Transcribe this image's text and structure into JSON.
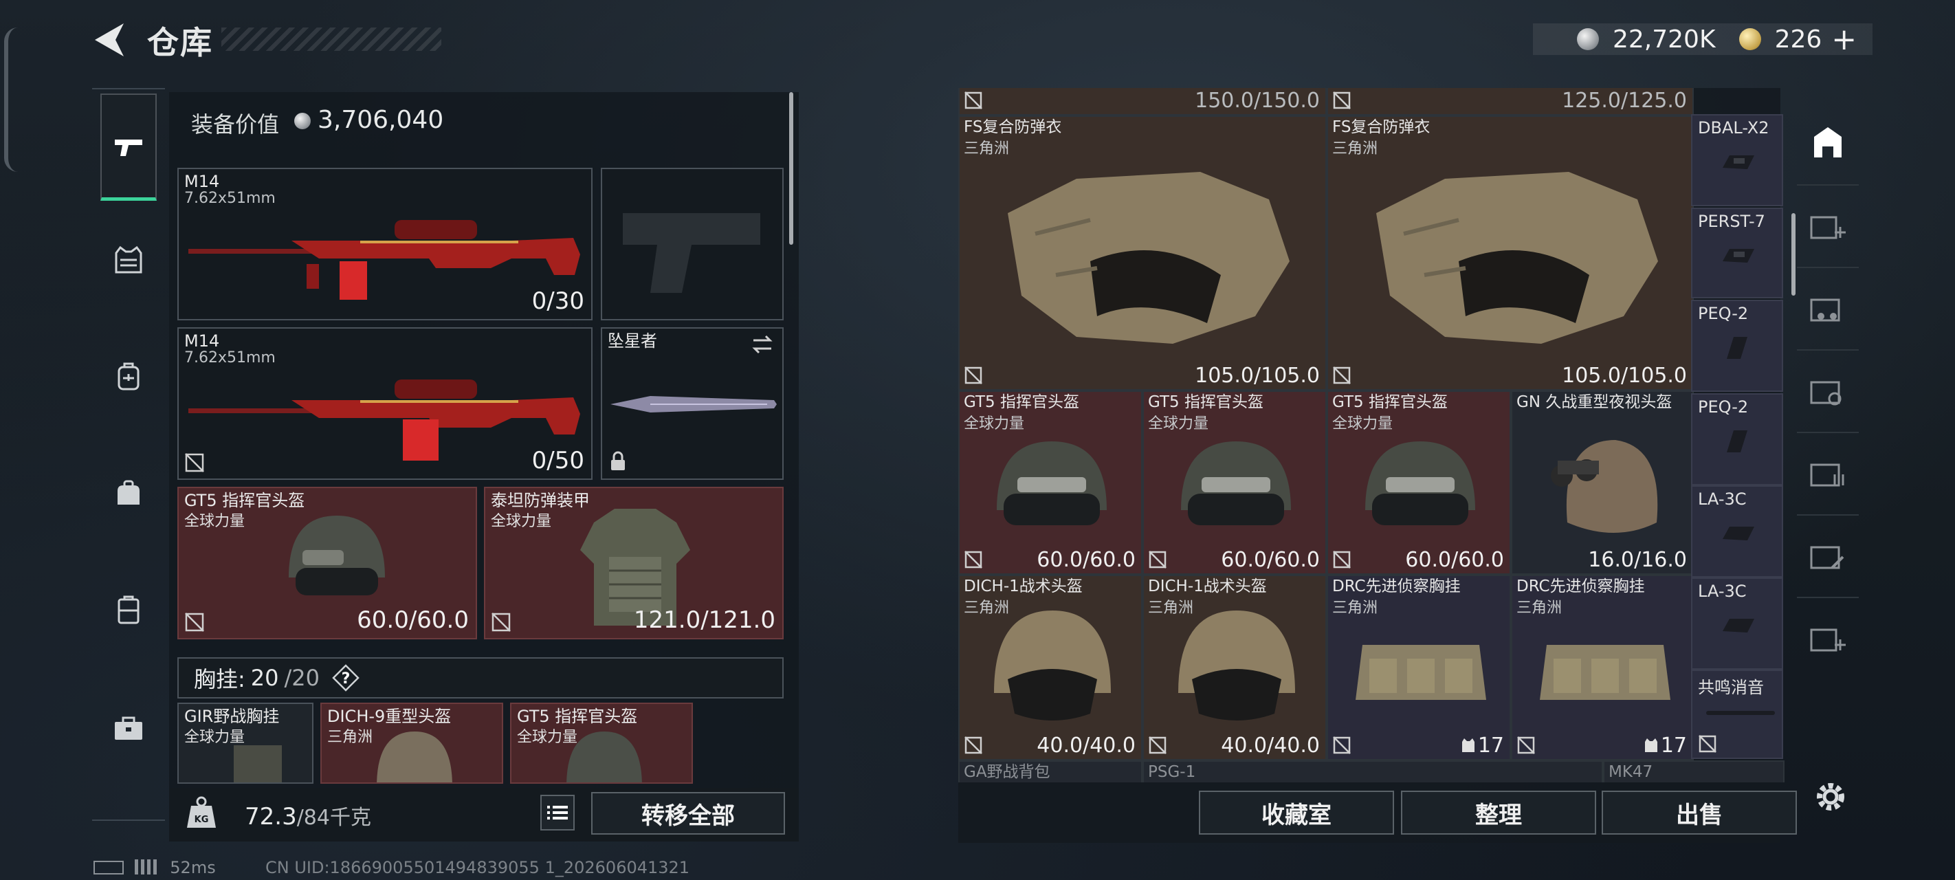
{
  "header": {
    "title": "仓库",
    "currency_silver": "22,720K",
    "currency_gold": "226",
    "currency_add": "+"
  },
  "left_panel": {
    "equip_value_label": "装备价值",
    "equip_value": "3,706,040",
    "weapon1": {
      "name": "M14",
      "caliber": "7.62x51mm",
      "ammo": "0/30"
    },
    "weapon2": {
      "name": "M14",
      "caliber": "7.62x51mm",
      "ammo": "0/50"
    },
    "melee": {
      "name": "坠星者"
    },
    "helmet": {
      "name": "GT5 指挥官头盔",
      "faction": "全球力量",
      "durability": "60.0/60.0"
    },
    "armor": {
      "name": "泰坦防弹装甲",
      "faction": "全球力量",
      "durability": "121.0/121.0"
    },
    "chest_rig": {
      "label": "胸挂:",
      "value": "20",
      "max": "/20",
      "help": "?"
    },
    "rig_items": [
      {
        "name": "GIR野战胸挂",
        "faction": "全球力量"
      },
      {
        "name": "DICH-9重型头盔",
        "faction": "三角洲"
      },
      {
        "name": "GT5 指挥官头盔",
        "faction": "全球力量"
      }
    ],
    "weight": "72.3",
    "weight_max": "/84千克",
    "transfer_all": "转移全部"
  },
  "stash": {
    "row0": [
      "150.0/150.0",
      "125.0/125.0"
    ],
    "vests": [
      {
        "name": "FS复合防弹衣",
        "faction": "三角洲",
        "durability": "105.0/105.0"
      },
      {
        "name": "FS复合防弹衣",
        "faction": "三角洲",
        "durability": "105.0/105.0"
      }
    ],
    "helmets_row": [
      {
        "name": "GT5 指挥官头盔",
        "faction": "全球力量",
        "durability": "60.0/60.0"
      },
      {
        "name": "GT5 指挥官头盔",
        "faction": "全球力量",
        "durability": "60.0/60.0"
      },
      {
        "name": "GT5 指挥官头盔",
        "faction": "全球力量",
        "durability": "60.0/60.0"
      },
      {
        "name": "GN 久战重型夜视头盔",
        "faction": "",
        "durability": "16.0/16.0"
      }
    ],
    "row3": [
      {
        "name": "DICH-1战术头盔",
        "faction": "三角洲",
        "value": "40.0/40.0"
      },
      {
        "name": "DICH-1战术头盔",
        "faction": "三角洲",
        "value": "40.0/40.0"
      },
      {
        "name": "DRC先进侦察胸挂",
        "faction": "三角洲",
        "value": "17"
      },
      {
        "name": "DRC先进侦察胸挂",
        "faction": "三角洲",
        "value": "17"
      }
    ],
    "row4": [
      "GA野战背包",
      "PSG-1",
      "MK47"
    ],
    "attachments": [
      "DBAL-X2",
      "PERST-7",
      "PEQ-2",
      "PEQ-2",
      "LA-3C",
      "LA-3C",
      "共鸣消音"
    ],
    "buttons": {
      "collection": "收藏室",
      "sort": "整理",
      "sell": "出售"
    }
  },
  "status": {
    "ping": "52ms",
    "uid": "CN UID:18669005501494839055 1_202606041321"
  },
  "colors": {
    "accent_green": "#3cd39a",
    "red_slot": "#4a2629",
    "brown_slot": "#3a2f29",
    "purple_slot": "#2b2d3e"
  }
}
